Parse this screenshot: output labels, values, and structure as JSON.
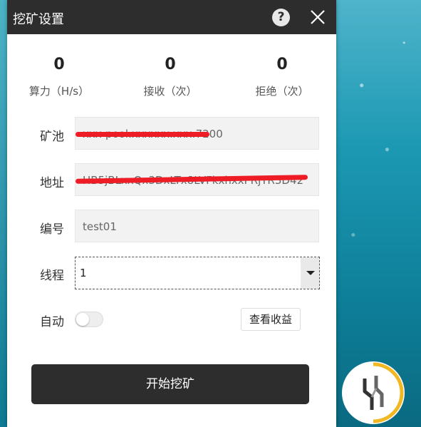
{
  "window": {
    "title": "挖矿设置"
  },
  "stats": [
    {
      "value": "0",
      "label": "算力（H/s）"
    },
    {
      "value": "0",
      "label": "接收（次）"
    },
    {
      "value": "0",
      "label": "拒绝（次）"
    }
  ],
  "form": {
    "pool_label": "矿池",
    "pool_value": "xxx-pool.xxxxxx.xxx:7200",
    "address_label": "地址",
    "address_value": "HB5jBLxxQx3DxLTx8LVFkxhxxPRjYR3D42",
    "id_label": "编号",
    "id_value": "test01",
    "threads_label": "线程",
    "threads_value": "1",
    "auto_label": "自动",
    "auto_enabled": false,
    "earnings_button": "查看收益",
    "start_button": "开始挖矿"
  },
  "colors": {
    "titlebar": "#2d2d2d",
    "redaction": "#ee1c25",
    "logo_ring": "#f2b824"
  },
  "icons": [
    "help-icon",
    "close-icon",
    "dropdown-arrow-icon",
    "app-logo-icon"
  ]
}
